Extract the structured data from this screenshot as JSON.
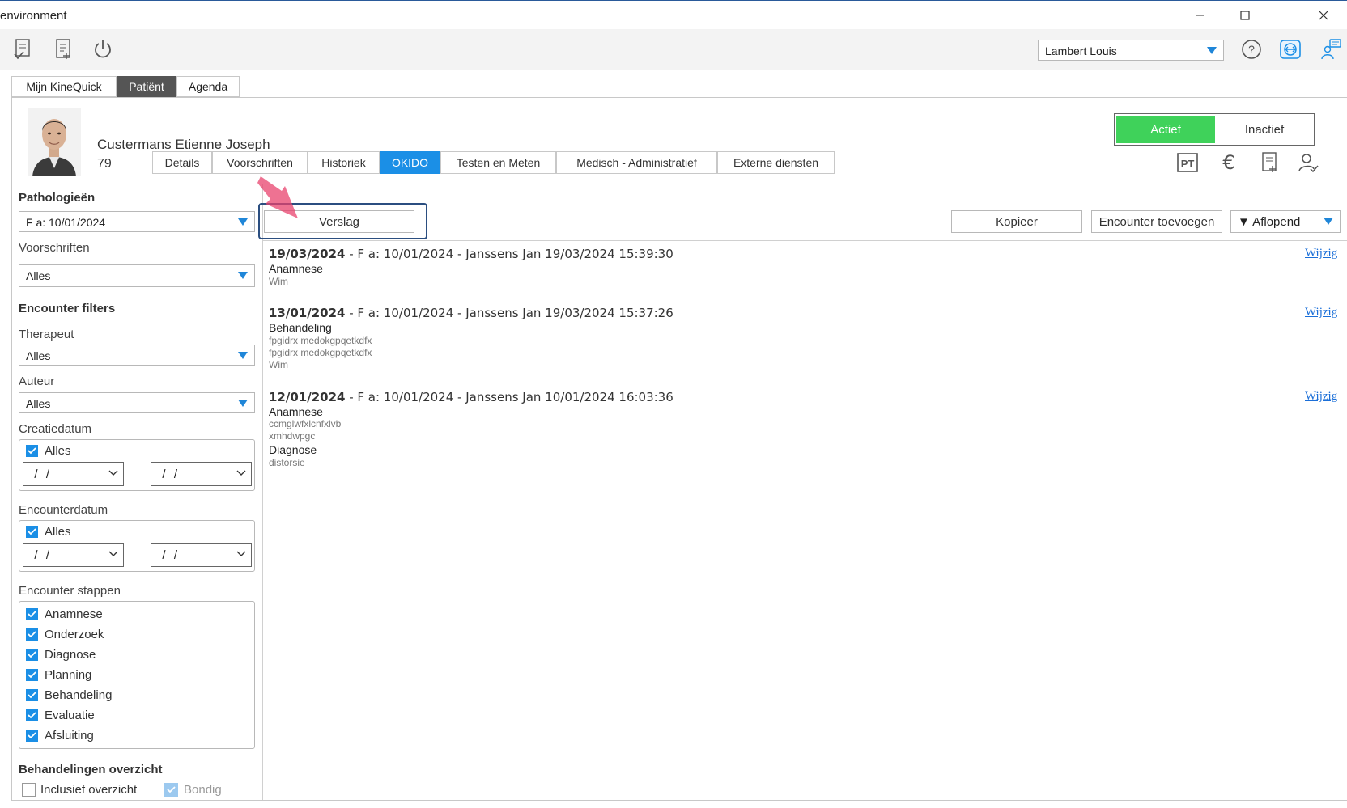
{
  "window": {
    "title": "environment"
  },
  "toolbar": {
    "user": "Lambert Louis"
  },
  "main_tabs": [
    {
      "label": "Mijn KineQuick",
      "active": false
    },
    {
      "label": "Patiënt",
      "active": true
    },
    {
      "label": "Agenda",
      "active": false
    }
  ],
  "patient": {
    "name": "Custermans Etienne Joseph",
    "number": "79",
    "status_options": [
      "Actief",
      "Inactief"
    ],
    "status_selected": "Actief",
    "header_icons": [
      "pt-icon",
      "euro-icon",
      "document-add-icon",
      "person-check-icon"
    ]
  },
  "sub_tabs": [
    {
      "label": "Details",
      "active": false
    },
    {
      "label": "Voorschriften",
      "active": false
    },
    {
      "label": "Historiek",
      "active": false
    },
    {
      "label": "OKIDO",
      "active": true
    },
    {
      "label": "Testen en Meten",
      "active": false
    },
    {
      "label": "Medisch - Administratief",
      "active": false
    },
    {
      "label": "Externe diensten",
      "active": false
    }
  ],
  "filters": {
    "pathologies_title": "Pathologieën",
    "pathology_value": "F a: 10/01/2024",
    "prescriptions_label": "Voorschriften",
    "prescriptions_value": "Alles",
    "encounter_filters_title": "Encounter filters",
    "therapist_label": "Therapeut",
    "therapist_value": "Alles",
    "author_label": "Auteur",
    "author_value": "Alles",
    "creation_date_label": "Creatiedatum",
    "creation_all_label": "Alles",
    "creation_all_checked": true,
    "creation_from": "_/_/___",
    "creation_to": "_/_/___",
    "encounter_date_label": "Encounterdatum",
    "encounter_all_label": "Alles",
    "encounter_all_checked": true,
    "encounter_from": "_/_/___",
    "encounter_to": "_/_/___",
    "steps_label": "Encounter stappen",
    "steps": [
      {
        "label": "Anamnese",
        "checked": true
      },
      {
        "label": "Onderzoek",
        "checked": true
      },
      {
        "label": "Diagnose",
        "checked": true
      },
      {
        "label": "Planning",
        "checked": true
      },
      {
        "label": "Behandeling",
        "checked": true
      },
      {
        "label": "Evaluatie",
        "checked": true
      },
      {
        "label": "Afsluiting",
        "checked": true
      }
    ],
    "overview_title": "Behandelingen overzicht",
    "inclusive_label": "Inclusief overzicht",
    "inclusive_checked": false,
    "concise_label": "Bondig",
    "concise_checked": true
  },
  "actions": {
    "report": "Verslag",
    "copy": "Kopieer",
    "add_encounter": "Encounter toevoegen",
    "sort": "▼ Aflopend"
  },
  "encounters": [
    {
      "date": "19/03/2024",
      "rest": " - F a: 10/01/2024 - Janssens Jan 19/03/2024 15:39:30",
      "edit": "Wijzig",
      "lines": [
        {
          "text": "Anamnese",
          "kind": "step"
        },
        {
          "text": "Wim",
          "kind": "note"
        }
      ]
    },
    {
      "date": "13/01/2024",
      "rest": " - F a: 10/01/2024 - Janssens Jan 19/03/2024 15:37:26",
      "edit": "Wijzig",
      "lines": [
        {
          "text": "Behandeling",
          "kind": "step"
        },
        {
          "text": "fpgidrx medokgpqetkdfx",
          "kind": "note"
        },
        {
          "text": "fpgidrx medokgpqetkdfx",
          "kind": "note"
        },
        {
          "text": "Wim",
          "kind": "note"
        }
      ]
    },
    {
      "date": "12/01/2024",
      "rest": " - F a: 10/01/2024 - Janssens Jan 10/01/2024 16:03:36",
      "edit": "Wijzig",
      "lines": [
        {
          "text": "Anamnese",
          "kind": "step"
        },
        {
          "text": "ccmglwfxlcnfxlvb",
          "kind": "note"
        },
        {
          "text": "xmhdwpgc",
          "kind": "note"
        },
        {
          "text": "Diagnose",
          "kind": "step"
        },
        {
          "text": "distorsie",
          "kind": "note"
        }
      ]
    }
  ]
}
